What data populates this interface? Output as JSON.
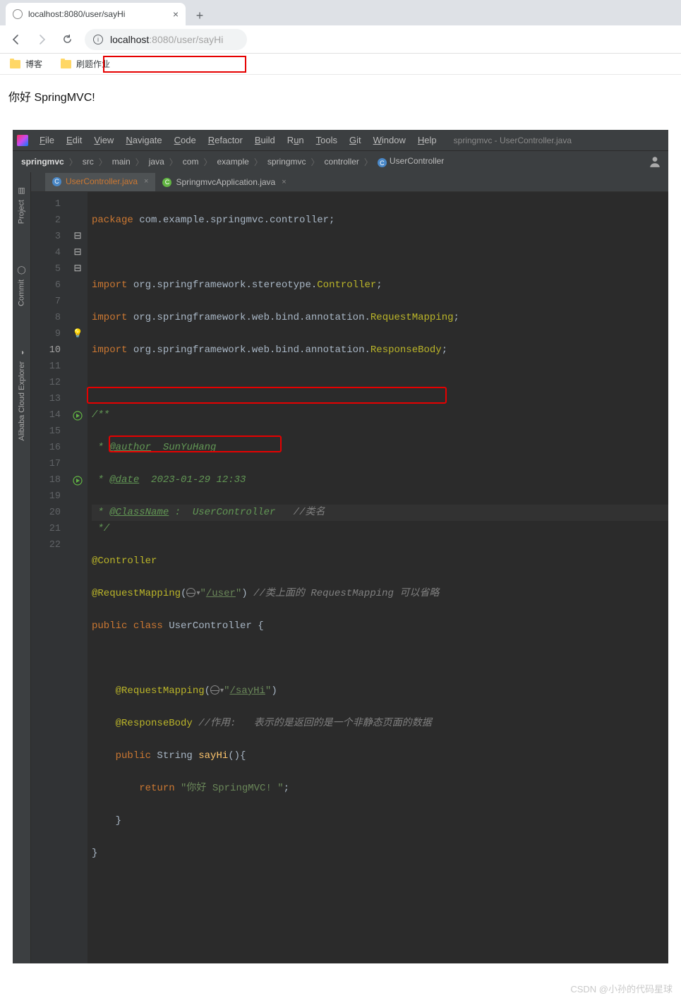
{
  "browser": {
    "tab_title": "localhost:8080/user/sayHi",
    "url_prefix": "localhost",
    "url_suffix": ":8080/user/sayHi",
    "bookmarks": [
      "博客",
      "刷题作业"
    ],
    "page_text": "你好 SpringMVC!"
  },
  "ide": {
    "title": "springmvc - UserController.java",
    "menu": [
      "File",
      "Edit",
      "View",
      "Navigate",
      "Code",
      "Refactor",
      "Build",
      "Run",
      "Tools",
      "Git",
      "Window",
      "Help"
    ],
    "breadcrumbs": [
      "springmvc",
      "src",
      "main",
      "java",
      "com",
      "example",
      "springmvc",
      "controller",
      "UserController"
    ],
    "rail": [
      "Project",
      "Commit",
      "Alibaba Cloud Explorer"
    ],
    "tabs": [
      {
        "name": "UserController.java",
        "active": true
      },
      {
        "name": "SpringmvcApplication.java",
        "active": false
      }
    ],
    "code": {
      "l1a": "package",
      "l1b": " com.example.springmvc.controller;",
      "l3a": "import",
      "l3b": " org.springframework.stereotype.",
      "l3c": "Controller",
      "l3d": ";",
      "l4a": "import",
      "l4b": " org.springframework.web.bind.annotation.",
      "l4c": "RequestMapping",
      "l4d": ";",
      "l5a": "import",
      "l5b": " org.springframework.web.bind.annotation.",
      "l5c": "ResponseBody",
      "l5d": ";",
      "l7": "/**",
      "l8a": " * ",
      "l8b": "@author",
      "l8c": "  SunYuHang",
      "l9a": " * ",
      "l9b": "@date",
      "l9c": "  2023-01-29 12:33",
      "l10a": " * ",
      "l10b": "@ClassName",
      "l10c": " :  UserController   ",
      "l10d": "//类名",
      "l11": " */",
      "l12": "@Controller",
      "l13a": "@RequestMapping",
      "l13b": "(",
      "l13c": "\"",
      "l13d": "/user",
      "l13e": "\"",
      "l13f": ") ",
      "l13g": "//类上面的 RequestMapping 可以省略",
      "l14a": "public ",
      "l14b": "class ",
      "l14c": "UserController ",
      "l14d": "{",
      "l16a": "@RequestMapping",
      "l16b": "(",
      "l16c": "\"",
      "l16d": "/sayHi",
      "l16e": "\"",
      "l16f": ")",
      "l17a": "@ResponseBody ",
      "l17b": "//作用:   表示的是返回的是一个非静态页面的数据",
      "l18a": "public ",
      "l18b": "String ",
      "l18c": "sayHi",
      "l18d": "(){",
      "l19a": "return ",
      "l19b": "\"你好 SpringMVC! \"",
      "l19c": ";",
      "l20": "}",
      "l21": "}"
    },
    "lines": 22
  },
  "watermark": "CSDN @小孙的代码星球"
}
